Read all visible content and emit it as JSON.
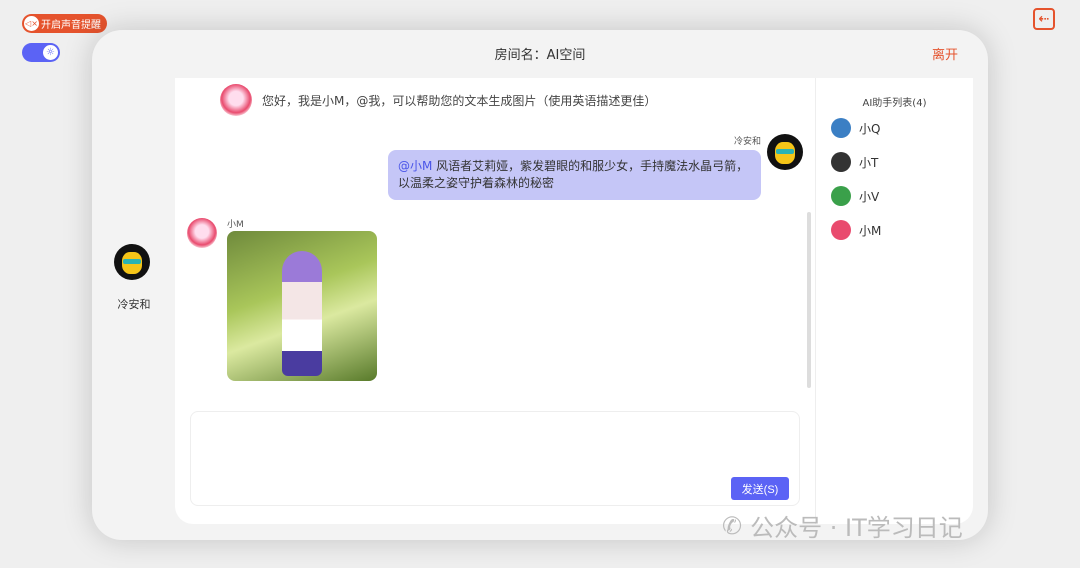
{
  "top": {
    "sound_label": "开启声音提醒"
  },
  "header": {
    "room": "房间名：AI空间",
    "leave": "离开"
  },
  "user": {
    "name": "冷安和"
  },
  "messages": [
    {
      "sender": "小M",
      "text": "您好，我是小M，@我，可以帮助您的文本生成图片（使用英语描述更佳）"
    },
    {
      "sender": "冷安和",
      "mention": "@小M",
      "text": " 风语者艾莉娅，紫发碧眼的和服少女，手持魔法水晶弓箭，以温柔之姿守护着森林的秘密"
    },
    {
      "sender": "小M",
      "type": "image"
    }
  ],
  "input": {
    "value": "",
    "send": "发送(S)"
  },
  "sidebar": {
    "title": "AI助手列表(4)",
    "items": [
      {
        "name": "小Q",
        "color": "#3b7fc4"
      },
      {
        "name": "小T",
        "color": "#333"
      },
      {
        "name": "小V",
        "color": "#3aa04a"
      },
      {
        "name": "小M",
        "color": "#e94b6e"
      }
    ]
  },
  "watermark": "公众号 · IT学习日记",
  "colors": {
    "accent": "#5b63f5",
    "danger": "#e5532d"
  }
}
